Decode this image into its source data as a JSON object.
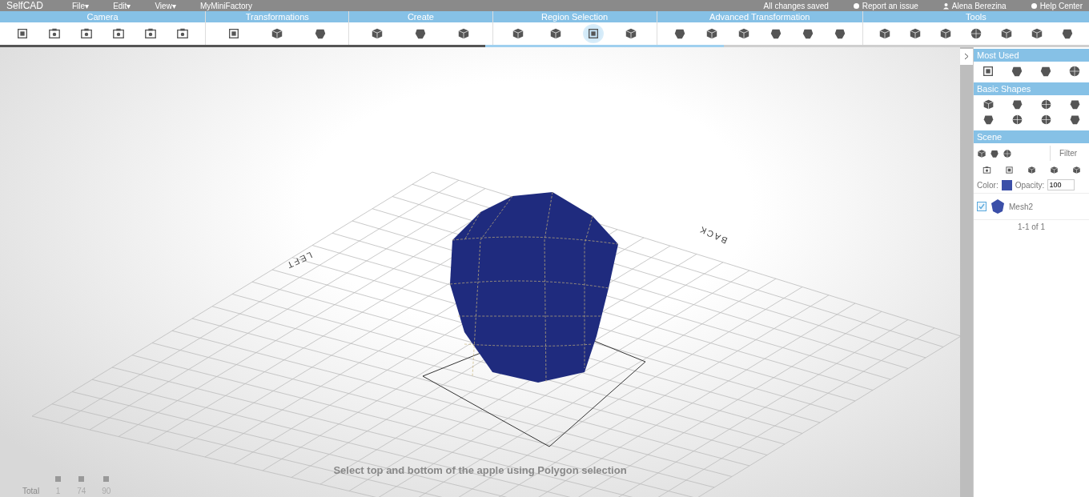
{
  "top_bar": {
    "logo": "SelfCAD",
    "menus": [
      "File▾",
      "Edit▾",
      "View▾",
      "MyMiniFactory"
    ],
    "status": "All changes saved",
    "links": [
      {
        "kind": "info",
        "label": "Report an issue"
      },
      {
        "kind": "user",
        "label": "Alena Berezina"
      },
      {
        "kind": "help",
        "label": "Help Center"
      }
    ]
  },
  "toolbar": {
    "groups": [
      {
        "label": "Camera",
        "tools": [
          {
            "kind": "frame",
            "selected": false
          },
          {
            "kind": "camera",
            "selected": false
          },
          {
            "kind": "camera",
            "selected": false
          },
          {
            "kind": "camera",
            "selected": false
          },
          {
            "kind": "camera",
            "selected": false
          },
          {
            "kind": "camera",
            "selected": false
          }
        ]
      },
      {
        "label": "Transformations",
        "tools": [
          {
            "kind": "frame",
            "selected": false
          },
          {
            "kind": "cube",
            "selected": false
          },
          {
            "kind": "shape",
            "selected": false
          }
        ]
      },
      {
        "label": "Create",
        "tools": [
          {
            "kind": "cube",
            "selected": false
          },
          {
            "kind": "shape",
            "selected": false
          },
          {
            "kind": "cube",
            "selected": false
          }
        ]
      },
      {
        "label": "Region Selection",
        "tools": [
          {
            "kind": "cube",
            "selected": false
          },
          {
            "kind": "cube",
            "selected": false
          },
          {
            "kind": "frame",
            "selected": true
          },
          {
            "kind": "cube",
            "selected": false
          }
        ]
      },
      {
        "label": "Advanced Transformation",
        "tools": [
          {
            "kind": "shape",
            "selected": false
          },
          {
            "kind": "cube",
            "selected": false
          },
          {
            "kind": "cube",
            "selected": false
          },
          {
            "kind": "shape",
            "selected": false
          },
          {
            "kind": "shape",
            "selected": false
          },
          {
            "kind": "shape",
            "selected": false
          }
        ]
      },
      {
        "label": "Tools",
        "tools": [
          {
            "kind": "cube",
            "selected": false
          },
          {
            "kind": "cube",
            "selected": false
          },
          {
            "kind": "cube",
            "selected": false
          },
          {
            "kind": "sphere",
            "selected": false
          },
          {
            "kind": "cube",
            "selected": false
          },
          {
            "kind": "cube",
            "selected": false
          },
          {
            "kind": "shape",
            "selected": false
          }
        ]
      }
    ],
    "progress": {
      "level": 0.665
    }
  },
  "viewport": {
    "axis_labels": [
      {
        "kind": "left",
        "label": "LEFT"
      },
      {
        "kind": "back",
        "label": "BACK"
      }
    ],
    "caption": "Select top and bottom of the apple using Polygon selection",
    "stats": {
      "label": "Total",
      "counts": [
        "1",
        "74",
        "90"
      ]
    }
  },
  "panel": {
    "most_used": {
      "title": "Most Used",
      "tools": [
        {
          "kind": "frame"
        },
        {
          "kind": "shape"
        },
        {
          "kind": "shape"
        },
        {
          "kind": "sphere"
        }
      ]
    },
    "basic_shapes": {
      "title": "Basic Shapes",
      "tools": [
        {
          "kind": "cube"
        },
        {
          "kind": "shape"
        },
        {
          "kind": "sphere"
        },
        {
          "kind": "shape"
        },
        {
          "kind": "shape"
        },
        {
          "kind": "sphere"
        },
        {
          "kind": "sphere"
        },
        {
          "kind": "shape"
        }
      ]
    },
    "scene": {
      "title": "Scene",
      "filter_placeholder": "Filter",
      "color_label": "Color:",
      "color": "#3b4fa8",
      "opacity_label": "Opacity:",
      "opacity": "100",
      "items": [
        {
          "name": "Mesh2",
          "checked": true
        }
      ],
      "pager": "1-1 of 1"
    }
  }
}
